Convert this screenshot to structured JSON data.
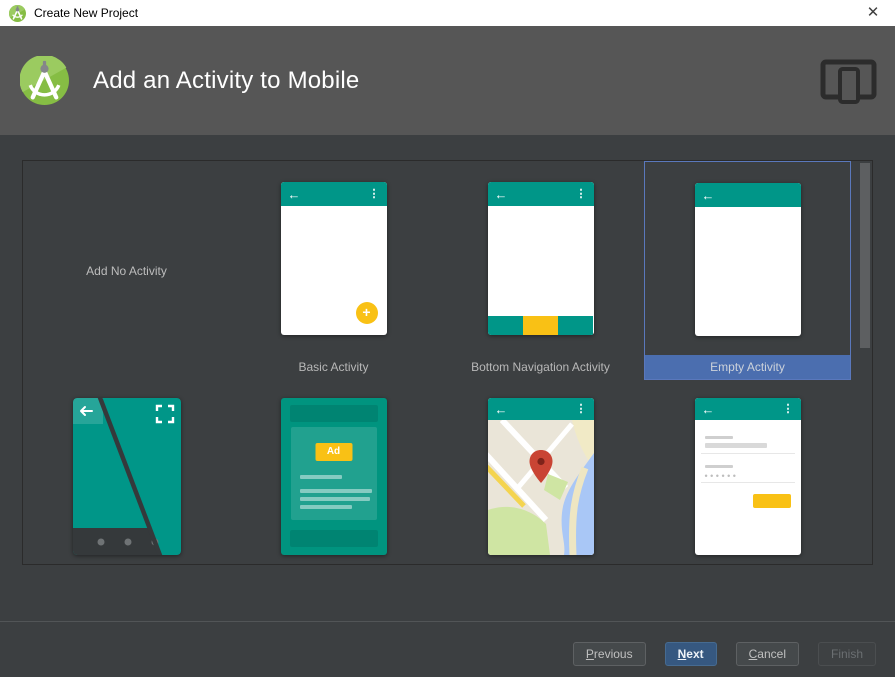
{
  "window": {
    "title": "Create New Project"
  },
  "titlebar": {
    "close_glyph": "✕"
  },
  "header": {
    "title": "Add an Activity to Mobile"
  },
  "gallery": {
    "glyphs": {
      "back": "←",
      "menu": "⋮",
      "fab_plus": "+"
    },
    "row1": [
      {
        "label": "Add No Activity",
        "selected": false
      },
      {
        "label": "Basic Activity",
        "selected": false
      },
      {
        "label": "Bottom Navigation Activity",
        "selected": false
      },
      {
        "label": "Empty Activity",
        "selected": true
      }
    ],
    "row2": {
      "thumbnails": [
        "fullscreen-activity",
        "ads-activity",
        "maps-activity",
        "login-activity"
      ],
      "ad_badge": "Ad",
      "password_dots": "••••••"
    }
  },
  "footer": {
    "buttons": [
      {
        "name": "previous",
        "mnemonic": "P",
        "rest": "revious",
        "enabled": true,
        "default": false
      },
      {
        "name": "next",
        "mnemonic": "N",
        "rest": "ext",
        "enabled": true,
        "default": true
      },
      {
        "name": "cancel",
        "mnemonic": "C",
        "rest": "ancel",
        "enabled": true,
        "default": false
      },
      {
        "name": "finish",
        "mnemonic": "",
        "rest": "Finish",
        "enabled": false,
        "default": false
      }
    ]
  },
  "colors": {
    "teal_accent": "#009688",
    "amber_accent": "#f9c115",
    "selection_blue": "#4b6eaf",
    "default_button_blue": "#365880",
    "header_gray": "#565656",
    "background": "#3c3f41"
  }
}
